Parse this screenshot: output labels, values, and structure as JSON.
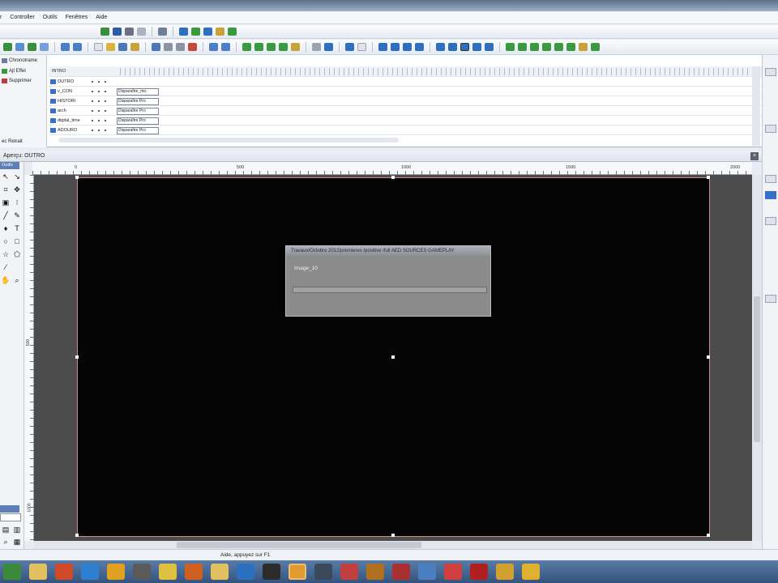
{
  "menu": [
    "Controller",
    "Outils",
    "Fenêtres",
    "Aide"
  ],
  "timeline": {
    "left_items": [
      "Chronotrame",
      "Ajt Effet",
      "Supprimer"
    ],
    "left_bottom": "ec Retrait",
    "header_label": "INTRO",
    "layers": [
      {
        "name": "OUTRO",
        "effect": ""
      },
      {
        "name": "v_CON",
        "effect": "Disparaître_mo."
      },
      {
        "name": "HISTORI",
        "effect": "Disparaître Pro"
      },
      {
        "name": "arch",
        "effect": "Disparaître Pro"
      },
      {
        "name": "digital_time",
        "effect": "Disparaître Pro"
      },
      {
        "name": "ADOURO",
        "effect": "Disparaître Pro"
      }
    ]
  },
  "preview": {
    "title": "Aperçu: OUTRO",
    "tools_title": "Outils",
    "ruler_labels": [
      "0",
      "500",
      "1000",
      "1500",
      "2000"
    ],
    "vruler_labels": [
      "500",
      "1000"
    ]
  },
  "dialog": {
    "title": "Travaux/Octobre 2012/premieres /positive /full AED SOURCES GAMEPLAY",
    "message": "Image_10",
    "progress": 0.0
  },
  "status": {
    "text": "Aide, appuyez sur F1"
  },
  "colors": {
    "canvas": "#050505",
    "canvas_frame": "#4c4c4c",
    "taskbar": "#3f6190"
  }
}
